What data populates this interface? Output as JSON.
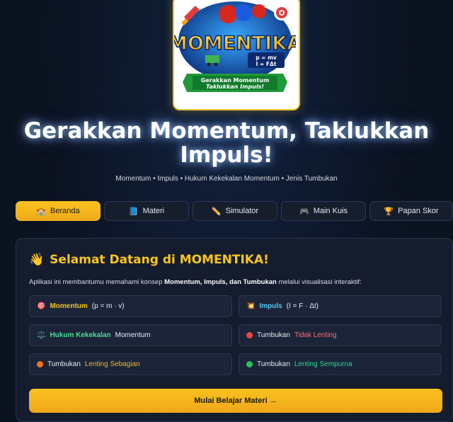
{
  "logo": {
    "wordmark": "MOMENTIKA",
    "formula1": "p = mv",
    "formula2": "I = FΔt",
    "ribbon_line1": "Gerakkan Momentum",
    "ribbon_line2": "Taklukkan Impuls!"
  },
  "hero": {
    "headline": "Gerakkan Momentum, Taklukkan Impuls!",
    "subline": "Momentum • Impuls • Hukum Kekekalan Momentum • Jenis Tumbukan"
  },
  "tabs": [
    {
      "icon": "🏫",
      "label": "Beranda",
      "active": true
    },
    {
      "icon": "📘",
      "label": "Materi",
      "active": false
    },
    {
      "icon": "✏️",
      "label": "Simulator",
      "active": false
    },
    {
      "icon": "🎮",
      "label": "Main Kuis",
      "active": false
    },
    {
      "icon": "🏆",
      "label": "Papan Skor",
      "active": false
    }
  ],
  "welcome": {
    "wave_icon": "👋",
    "title": "Selamat Datang di MOMENTIKA!",
    "intro_prefix": "Aplikasi ini membantumu memahami konsep ",
    "intro_bold": "Momentum, Impuls, dan Tumbukan",
    "intro_suffix": " melalui visualisasi interaktif:"
  },
  "features": {
    "momentum": {
      "icon": "🎯",
      "label": "Momentum",
      "formula": "(p = m · v)"
    },
    "impuls": {
      "icon": "💥",
      "label": "Impuls",
      "formula": "(I = F · Δt)"
    },
    "hukum": {
      "icon": "⚖️",
      "label": "Hukum Kekekalan",
      "rest": "Momentum"
    },
    "tidak_lenting": {
      "prefix": "Tumbukan",
      "label": "Tidak Lenting",
      "color": "#f87171"
    },
    "lenting_sebagian": {
      "prefix": "Tumbukan",
      "label": "Lenting Sebagian",
      "color": "#f59e42"
    },
    "lenting_sempurna": {
      "prefix": "Tumbukan",
      "label": "Lenting Sempurna",
      "color": "#34d399"
    }
  },
  "cta": {
    "label": "Mulai Belajar Materi →"
  },
  "colors": {
    "accent": "#f7c520",
    "background": "#0b1220",
    "card": "#141c2d"
  }
}
